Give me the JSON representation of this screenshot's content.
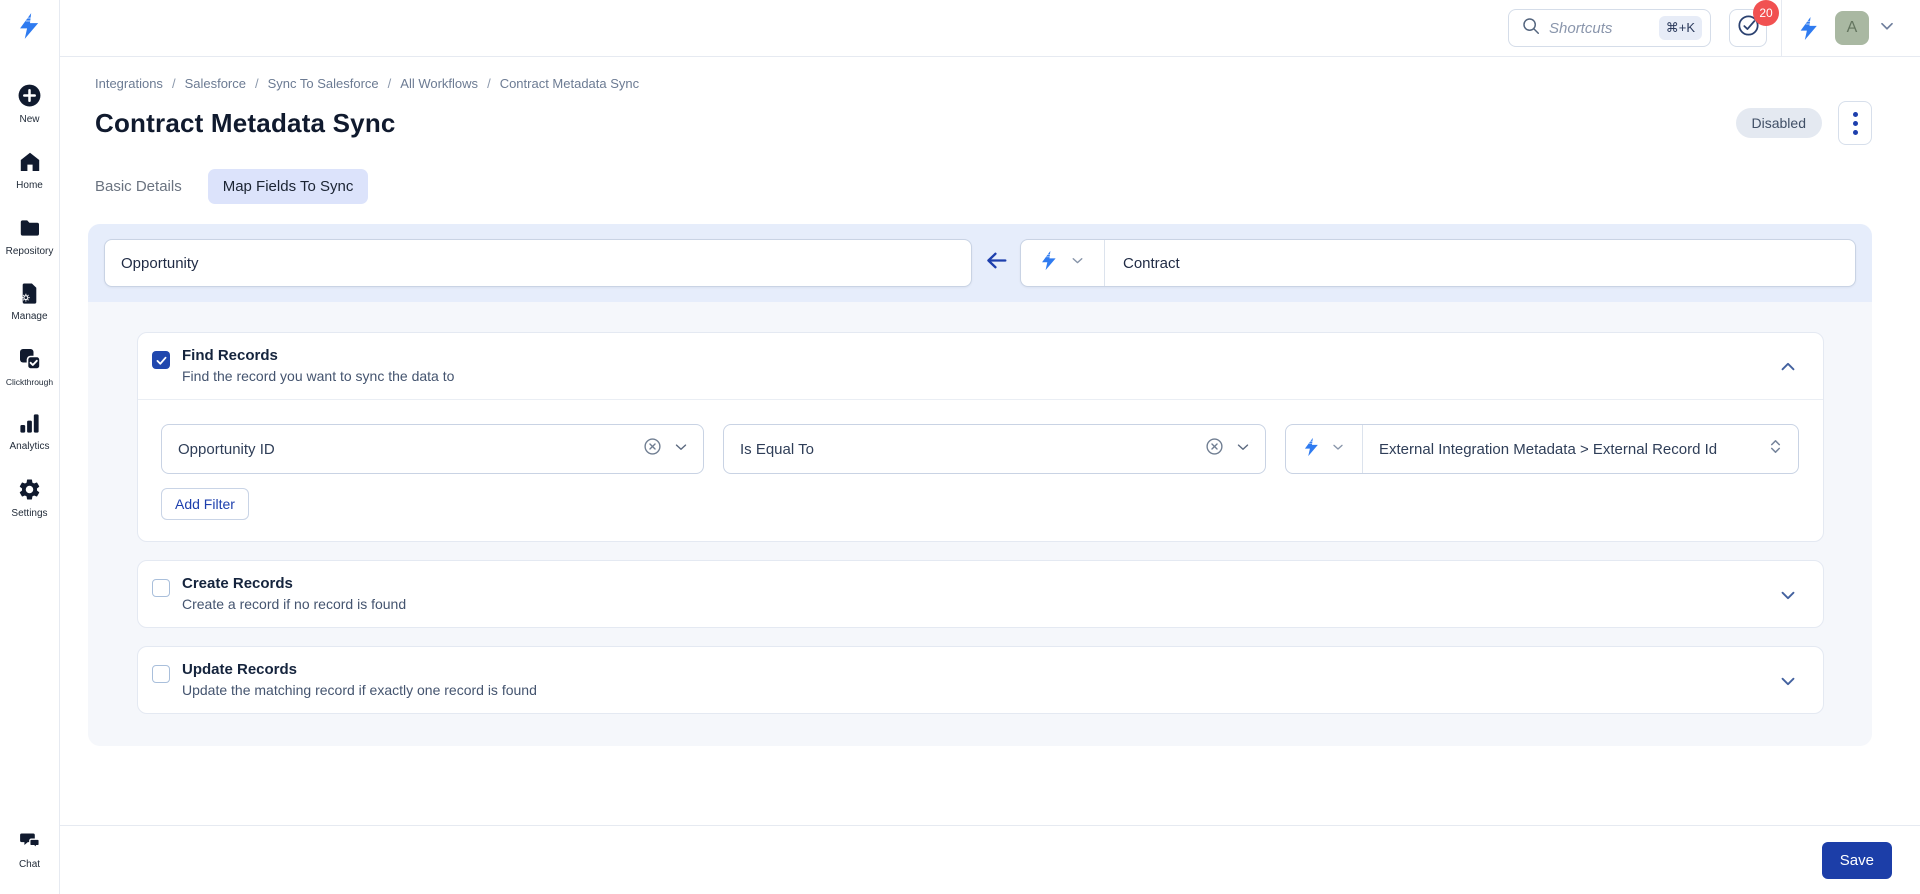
{
  "topbar": {
    "search_placeholder": "Shortcuts",
    "search_shortcut": "⌘+K",
    "notification_count": "20",
    "avatar_letter": "A"
  },
  "sidebar": {
    "items": [
      {
        "label": "New"
      },
      {
        "label": "Home"
      },
      {
        "label": "Repository"
      },
      {
        "label": "Manage"
      },
      {
        "label": "Clickthrough"
      },
      {
        "label": "Analytics"
      },
      {
        "label": "Settings"
      }
    ],
    "bottom": {
      "label": "Chat"
    }
  },
  "breadcrumb": {
    "separator": "/",
    "items": [
      "Integrations",
      "Salesforce",
      "Sync To Salesforce",
      "All Workflows",
      "Contract Metadata Sync"
    ]
  },
  "page": {
    "title": "Contract Metadata Sync",
    "status_badge": "Disabled"
  },
  "tabs": [
    {
      "label": "Basic Details",
      "active": false
    },
    {
      "label": "Map Fields To Sync",
      "active": true
    }
  ],
  "mapping": {
    "source_object": "Opportunity",
    "target_object": "Contract"
  },
  "sections": {
    "find": {
      "title": "Find Records",
      "subtitle": "Find the record you want to sync the data to",
      "checked": true,
      "filter": {
        "field": "Opportunity ID",
        "operator": "Is Equal To",
        "value": "External Integration Metadata > External Record Id"
      },
      "add_filter_label": "Add Filter"
    },
    "create": {
      "title": "Create Records",
      "subtitle": "Create a record if no record is found",
      "checked": false
    },
    "update": {
      "title": "Update Records",
      "subtitle": "Update the matching record if exactly one record is found",
      "checked": false
    }
  },
  "footer": {
    "save_label": "Save"
  },
  "colors": {
    "accent_blue": "#2F7BF0",
    "primary_button": "#1C3EA8",
    "notification_red": "#F15151",
    "avatar_bg": "#A9B8A2",
    "active_tab_bg": "#DCE3FB",
    "panel_header_bg": "#E6EDFB",
    "panel_body_bg": "#F5F7FB"
  }
}
